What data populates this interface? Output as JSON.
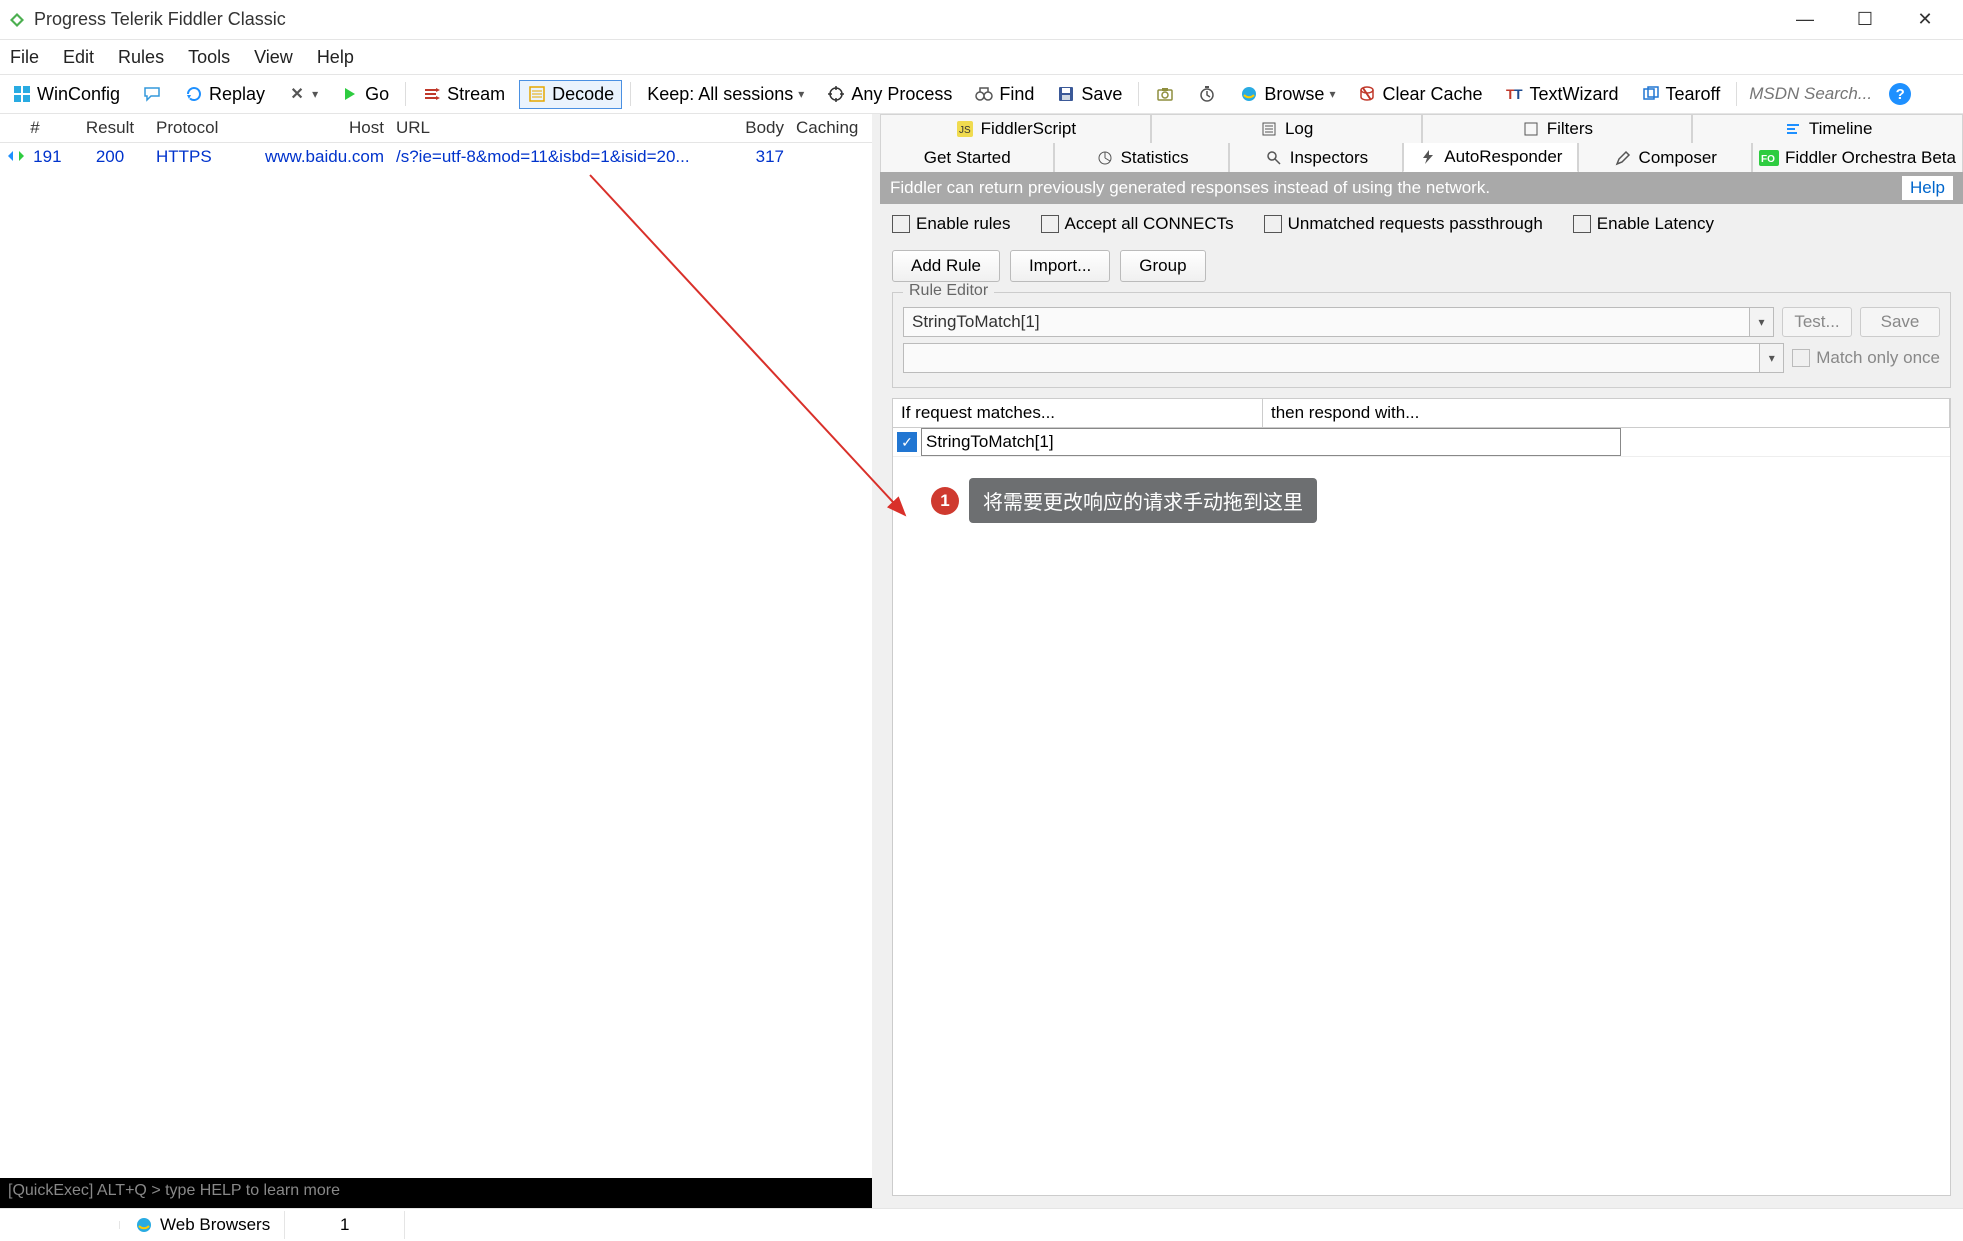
{
  "window": {
    "title": "Progress Telerik Fiddler Classic"
  },
  "menu": {
    "file": "File",
    "edit": "Edit",
    "rules": "Rules",
    "tools": "Tools",
    "view": "View",
    "help": "Help"
  },
  "toolbar": {
    "winconfig": "WinConfig",
    "replay": "Replay",
    "go": "Go",
    "stream": "Stream",
    "decode": "Decode",
    "keep": "Keep: All sessions",
    "anyprocess": "Any Process",
    "find": "Find",
    "save": "Save",
    "browse": "Browse",
    "clearcache": "Clear Cache",
    "textwizard": "TextWizard",
    "tearoff": "Tearoff",
    "msdn_placeholder": "MSDN Search...",
    "x_symbol": "✕",
    "dropdown_caret": "▾"
  },
  "sessions": {
    "headers": {
      "id": "#",
      "result": "Result",
      "protocol": "Protocol",
      "host": "Host",
      "url": "URL",
      "body": "Body",
      "caching": "Caching"
    },
    "rows": [
      {
        "id": "191",
        "result": "200",
        "protocol": "HTTPS",
        "host": "www.baidu.com",
        "url": "/s?ie=utf-8&mod=11&isbd=1&isid=20...",
        "body": "317",
        "caching": ""
      }
    ]
  },
  "quickexec": "[QuickExec] ALT+Q > type HELP to learn more",
  "right_tabs_row1": {
    "fiddlerscript": "FiddlerScript",
    "log": "Log",
    "filters": "Filters",
    "timeline": "Timeline"
  },
  "right_tabs_row2": {
    "getstarted": "Get Started",
    "statistics": "Statistics",
    "inspectors": "Inspectors",
    "autoresponder": "AutoResponder",
    "composer": "Composer",
    "fiddlerorchestra": "Fiddler Orchestra Beta"
  },
  "autoresponder": {
    "info": "Fiddler can return previously generated responses instead of using the network.",
    "help": "Help",
    "enable_rules": "Enable rules",
    "accept_connects": "Accept all CONNECTs",
    "unmatched": "Unmatched requests passthrough",
    "enable_latency": "Enable Latency",
    "add_rule": "Add Rule",
    "import": "Import...",
    "group": "Group",
    "rule_editor_title": "Rule Editor",
    "match_value": "StringToMatch[1]",
    "respond_value": "",
    "test": "Test...",
    "save": "Save",
    "match_only_once": "Match only once",
    "col_match": "If request matches...",
    "col_respond": "then respond with...",
    "rule_text": "StringToMatch[1]",
    "annotation_num": "1",
    "annotation_text": "将需要更改响应的请求手动拖到这里"
  },
  "status": {
    "web_browsers": "Web Browsers",
    "count": "1"
  }
}
